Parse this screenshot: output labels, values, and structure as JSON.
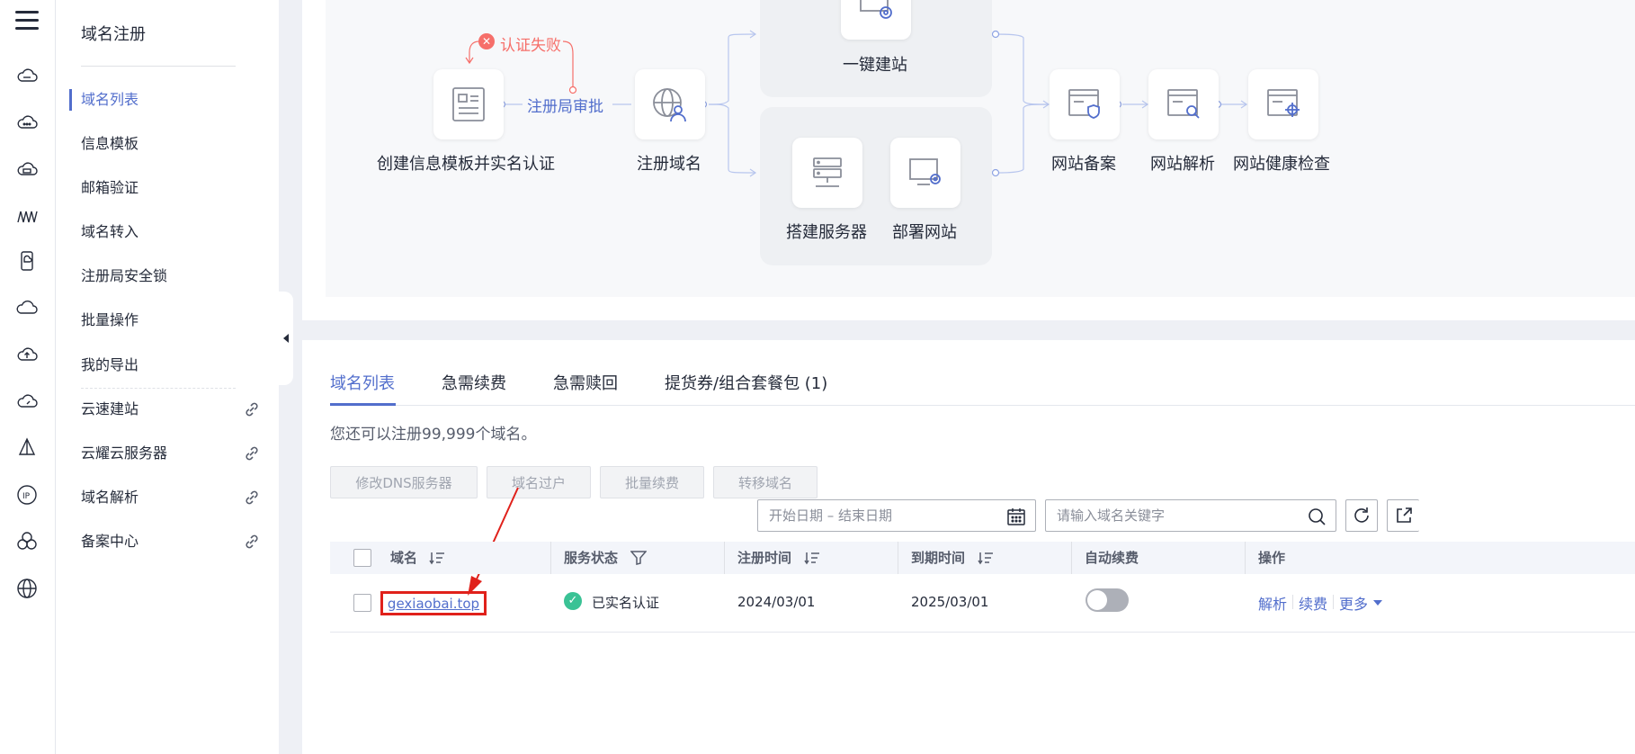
{
  "menu": {
    "title": "域名注册",
    "items": [
      {
        "label": "域名列表"
      },
      {
        "label": "信息模板"
      },
      {
        "label": "邮箱验证"
      },
      {
        "label": "域名转入"
      },
      {
        "label": "注册局安全锁"
      },
      {
        "label": "批量操作"
      },
      {
        "label": "我的导出"
      },
      {
        "label": "云速建站"
      },
      {
        "label": "云耀云服务器"
      },
      {
        "label": "域名解析"
      },
      {
        "label": "备案中心"
      }
    ]
  },
  "flow": {
    "step1": "创建信息模板并实名认证",
    "fail": "认证失败",
    "approve": "注册局审批",
    "step2": "注册域名",
    "one_click": "一键建站",
    "build_server": "搭建服务器",
    "deploy_site": "部署网站",
    "icp": "网站备案",
    "dns": "网站解析",
    "health": "网站健康检查"
  },
  "list": {
    "tabs": [
      "域名列表",
      "急需续费",
      "急需赎回",
      "提货券/组合套餐包 (1)"
    ],
    "note": "您还可以注册99,999个域名。",
    "buttons": [
      "修改DNS服务器",
      "域名过户",
      "批量续费",
      "转移域名"
    ],
    "date_placeholder": "开始日期 – 结束日期",
    "search_placeholder": "请输入域名关键字",
    "columns": [
      "域名",
      "服务状态",
      "注册时间",
      "到期时间",
      "自动续费",
      "操作"
    ],
    "row": {
      "domain": "gexiaobai.top",
      "status": "已实名认证",
      "reg_date": "2024/03/01",
      "exp_date": "2025/03/01",
      "auto_renew": false,
      "actions": [
        "解析",
        "续费",
        "更多"
      ]
    }
  },
  "colors": {
    "accent": "#526ecc",
    "error": "#f66f6a",
    "highlight": "#e0211b",
    "success": "#3ac295"
  }
}
